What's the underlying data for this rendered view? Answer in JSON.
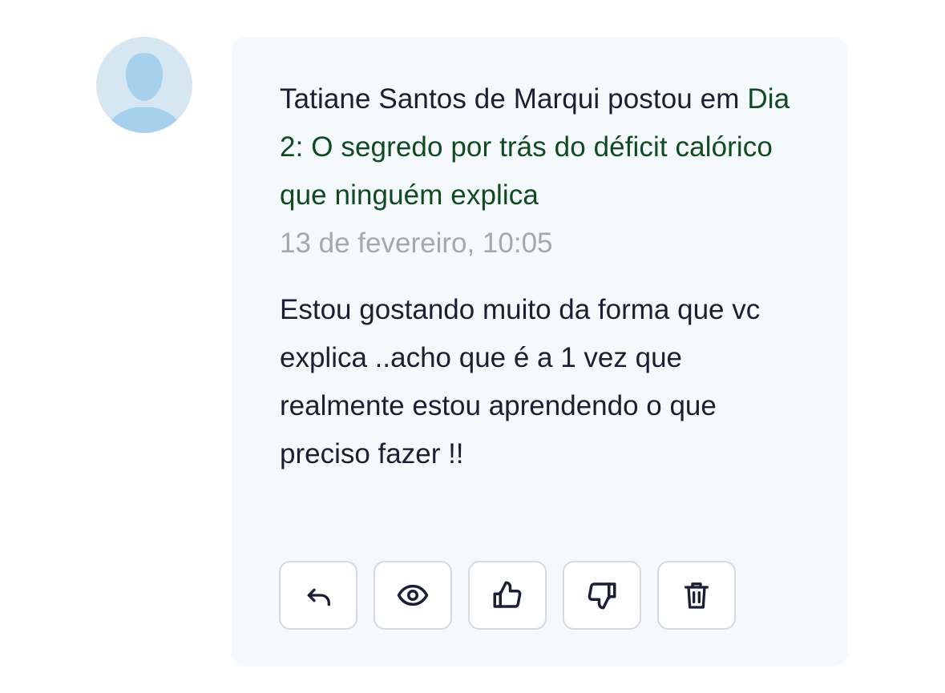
{
  "post": {
    "author": "Tatiane Santos de Marqui",
    "action_text": "postou em",
    "topic_title": "Dia 2: O segredo por trás do déficit calórico que ninguém explica",
    "timestamp": "13 de fevereiro, 10:05",
    "body": "Estou gostando muito da forma que vc explica ..acho que é a 1 vez que realmente estou aprendendo o que preciso fazer !!"
  },
  "actions": [
    {
      "name": "reply",
      "icon": "reply-icon"
    },
    {
      "name": "view",
      "icon": "eye-icon"
    },
    {
      "name": "like",
      "icon": "thumbs-up-icon"
    },
    {
      "name": "dislike",
      "icon": "thumbs-down-icon"
    },
    {
      "name": "delete",
      "icon": "trash-icon"
    }
  ],
  "colors": {
    "link": "#0f4a22",
    "text": "#1b1f33",
    "muted": "#a3a9b3",
    "card_background": "#f6f9fb",
    "avatar_background": "#d6e7f2",
    "avatar_figure": "#a8d1ee"
  }
}
